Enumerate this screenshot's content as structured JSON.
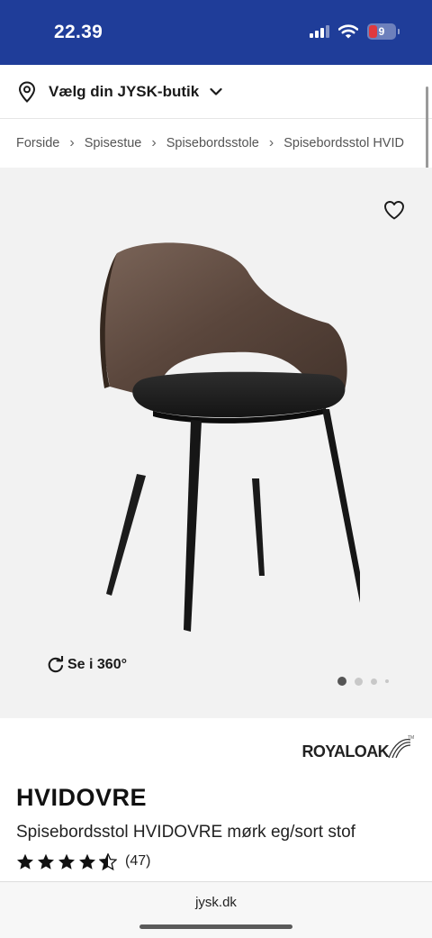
{
  "status_bar": {
    "time": "22.39",
    "battery_level": "9",
    "icons": [
      "cellular-signal-icon",
      "wifi-icon",
      "battery-icon"
    ],
    "background_color": "#1f3d99"
  },
  "store_selector": {
    "label": "Vælg din JYSK-butik",
    "icon": "location-pin-icon"
  },
  "breadcrumb": [
    "Forside",
    "Spisestue",
    "Spisebordsstole",
    "Spisebordsstol HVID"
  ],
  "gallery": {
    "view_360_label": "Se i 360°",
    "favorite_icon": "heart-outline-icon",
    "image_count": 4,
    "active_index": 0
  },
  "product": {
    "brand": "ROYALOAK",
    "brand_trademark": "TM",
    "name": "HVIDOVRE",
    "subtitle": "Spisebordsstol HVIDOVRE mørk eg/sort stof",
    "rating": 4.5,
    "review_count": "(47)"
  },
  "browser": {
    "url": "jysk.dk"
  }
}
